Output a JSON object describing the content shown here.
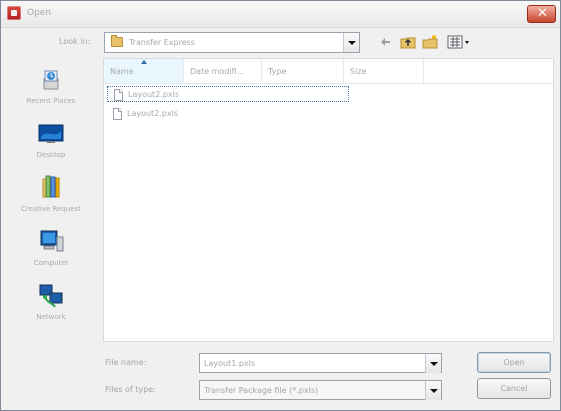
{
  "window": {
    "title": "Open",
    "app_icon": "app-logo-icon",
    "close_glyph": "✕"
  },
  "lookin": {
    "label": "Look in:",
    "value": "Transfer Express",
    "folder_icon": "folder-icon"
  },
  "toolbar": {
    "back_icon": "back-arrow-icon",
    "up_icon": "up-one-level-icon",
    "newfolder_icon": "new-folder-icon",
    "views_icon": "views-menu-icon"
  },
  "places": [
    {
      "label": "Recent Places",
      "icon": "recent-places-icon"
    },
    {
      "label": "Desktop",
      "icon": "desktop-icon"
    },
    {
      "label": "Creative Request",
      "icon": "library-icon"
    },
    {
      "label": "Computer",
      "icon": "computer-icon"
    },
    {
      "label": "Network",
      "icon": "network-icon"
    }
  ],
  "filelist": {
    "columns": [
      "Name",
      "Date modifi...",
      "Type",
      "Size"
    ],
    "files": [
      {
        "name": "Layout2.pxls",
        "selected": true
      },
      {
        "name": "Layout2.pxls",
        "selected": false
      }
    ]
  },
  "bottom": {
    "filename_label": "File name:",
    "filename_value": "Layout1.pxls",
    "filetype_label": "Files of type:",
    "filetype_value": "Transfer Package file (*.pxls)",
    "open_label": "Open",
    "cancel_label": "Cancel"
  },
  "colors": {
    "selected_border": "#4a6f9a",
    "header_sorted_bg": "#eaf6fd",
    "close_button": "#c7432f"
  }
}
